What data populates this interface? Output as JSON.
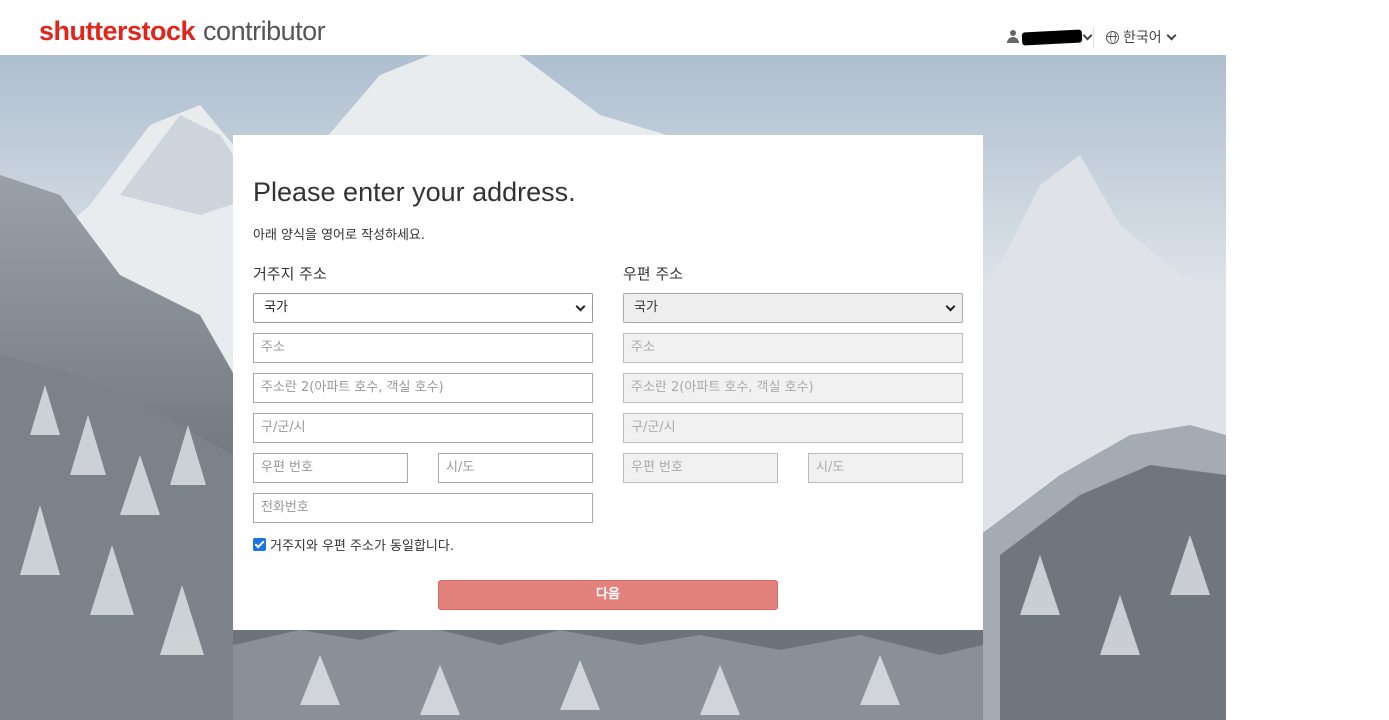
{
  "header": {
    "brand": "shutterstock",
    "product": "contributor",
    "user_name": "",
    "language": "한국어"
  },
  "form": {
    "title": "Please enter your address.",
    "instruction": "아래 양식을 영어로 작성하세요.",
    "residential": {
      "heading": "거주지 주소",
      "country_select": "국가",
      "address_placeholder": "주소",
      "address2_placeholder": "주소란 2(아파트 호수, 객실 호수)",
      "city_placeholder": "구/군/시",
      "postal_placeholder": "우편 번호",
      "state_placeholder": "시/도",
      "phone_placeholder": "전화번호"
    },
    "mailing": {
      "heading": "우편 주소",
      "country_select": "국가",
      "address_placeholder": "주소",
      "address2_placeholder": "주소란 2(아파트 호수, 객실 호수)",
      "city_placeholder": "구/군/시",
      "postal_placeholder": "우편 번호",
      "state_placeholder": "시/도"
    },
    "same_address_label": "거주지와 우편 주소가 동일합니다.",
    "same_address_checked": true,
    "next_button": "다음"
  },
  "colors": {
    "brand_red": "#e1251b",
    "next_button": "#e3827d",
    "checkbox": "#1a73e8"
  }
}
